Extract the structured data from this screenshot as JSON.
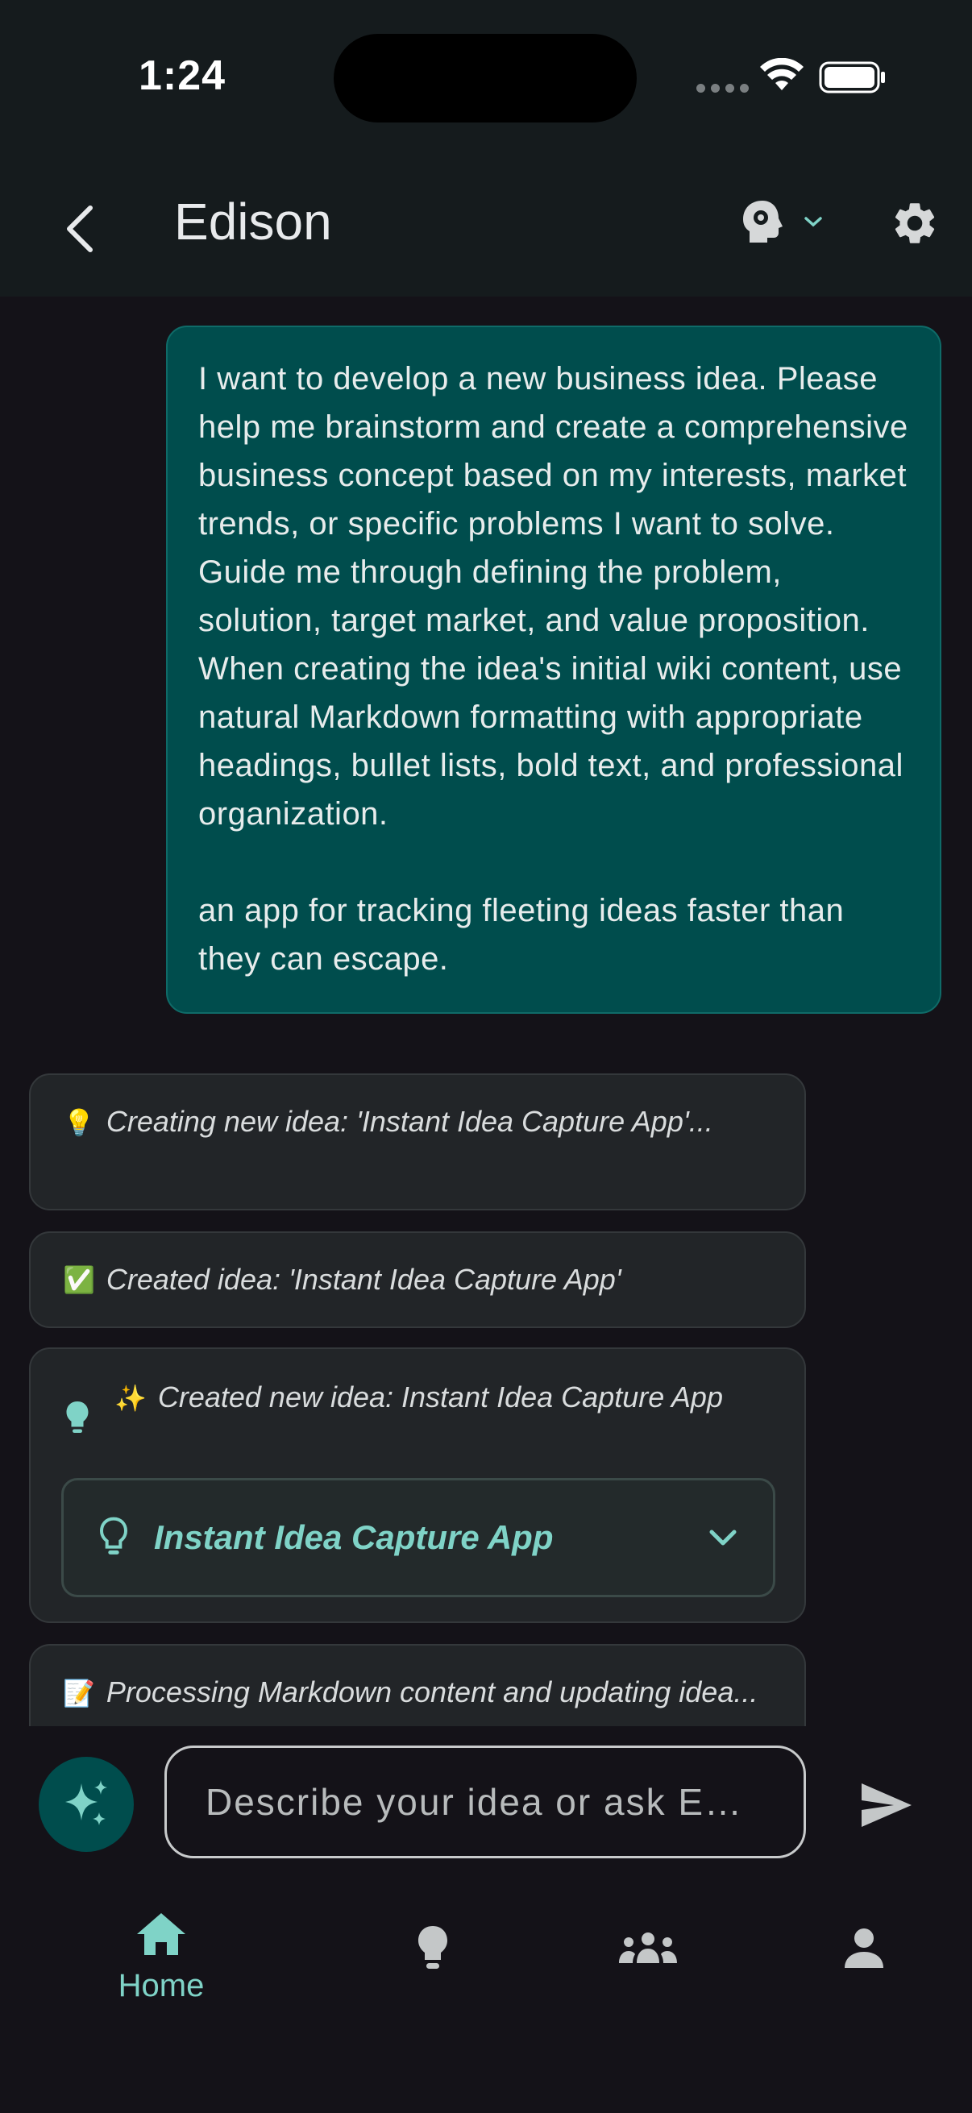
{
  "status_bar": {
    "time": "1:24"
  },
  "header": {
    "title": "Edison"
  },
  "chat": {
    "user_message": "I want to develop a new business idea. Please help me brainstorm and create a comprehensive business concept based on my interests, market trends, or specific problems I want to solve. Guide me through defining the problem, solution, target market, and value proposition. When creating the idea's initial wiki content, use natural Markdown formatting with appropriate headings, bullet lists, bold text, and professional organization.\n\nan app for tracking fleeting ideas faster than they can escape.",
    "status_messages": [
      {
        "emoji": "💡",
        "text": "Creating new idea: 'Instant Idea Capture App'..."
      },
      {
        "emoji": "✅",
        "text": "Created idea: 'Instant Idea Capture App'"
      },
      {
        "emoji": "✨",
        "text": "Created new idea: Instant Idea Capture App",
        "chip_label": "Instant Idea Capture App"
      },
      {
        "emoji": "📝",
        "text": "Processing Markdown content and updating idea..."
      }
    ]
  },
  "composer": {
    "placeholder": "Describe your idea or ask E…"
  },
  "bottom_nav": {
    "items": [
      {
        "label": "Home",
        "icon": "home-icon",
        "active": true
      },
      {
        "label": "",
        "icon": "lightbulb-icon"
      },
      {
        "label": "",
        "icon": "people-icon"
      },
      {
        "label": "",
        "icon": "person-icon"
      }
    ]
  },
  "colors": {
    "accent": "#7fd3c7",
    "user_bubble": "#004d4d",
    "background": "#141218",
    "header": "#151b1d"
  }
}
